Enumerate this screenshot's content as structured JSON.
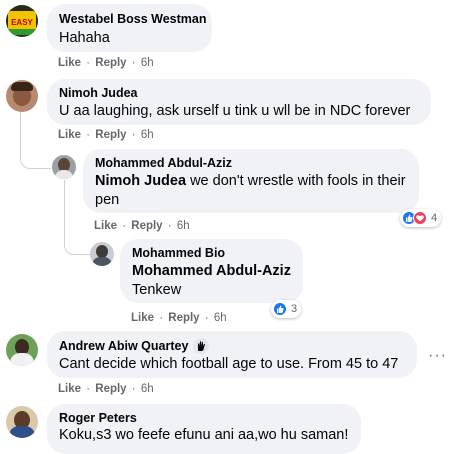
{
  "comments": [
    {
      "author": "Westabel Boss Westman",
      "text": "Hahaha",
      "like_label": "Like",
      "reply_label": "Reply",
      "time": "6h"
    },
    {
      "author": "Nimoh Judea",
      "text": "U aa laughing, ask urself u tink u wll be in NDC forever",
      "like_label": "Like",
      "reply_label": "Reply",
      "time": "6h"
    },
    {
      "author": "Mohammed Abdul-Aziz",
      "mention": "Nimoh Judea",
      "text": " we don't wrestle with fools in their pen",
      "like_label": "Like",
      "reply_label": "Reply",
      "time": "6h",
      "reaction_count": "4"
    },
    {
      "author": "Mohammed Bio",
      "mention": "Mohammed Abdul-Aziz",
      "text": "Tenkew",
      "like_label": "Like",
      "reply_label": "Reply",
      "time": "6h",
      "reaction_count": "3"
    },
    {
      "author": "Andrew Abiw Quartey",
      "text": "Cant decide which football age to use. From 45 to 47",
      "like_label": "Like",
      "reply_label": "Reply",
      "time": "6h",
      "more_label": "···"
    },
    {
      "author": "Roger Peters",
      "text": "Koku,s3 wo feefe efunu ani aa,wo hu saman!"
    }
  ],
  "avatar_badge_text": "EASY",
  "separator": "·",
  "colors": {
    "bubble": "#f0f2f5",
    "meta": "#65676b",
    "like_blue": "#1877f2",
    "love_red": "#f33e58"
  }
}
